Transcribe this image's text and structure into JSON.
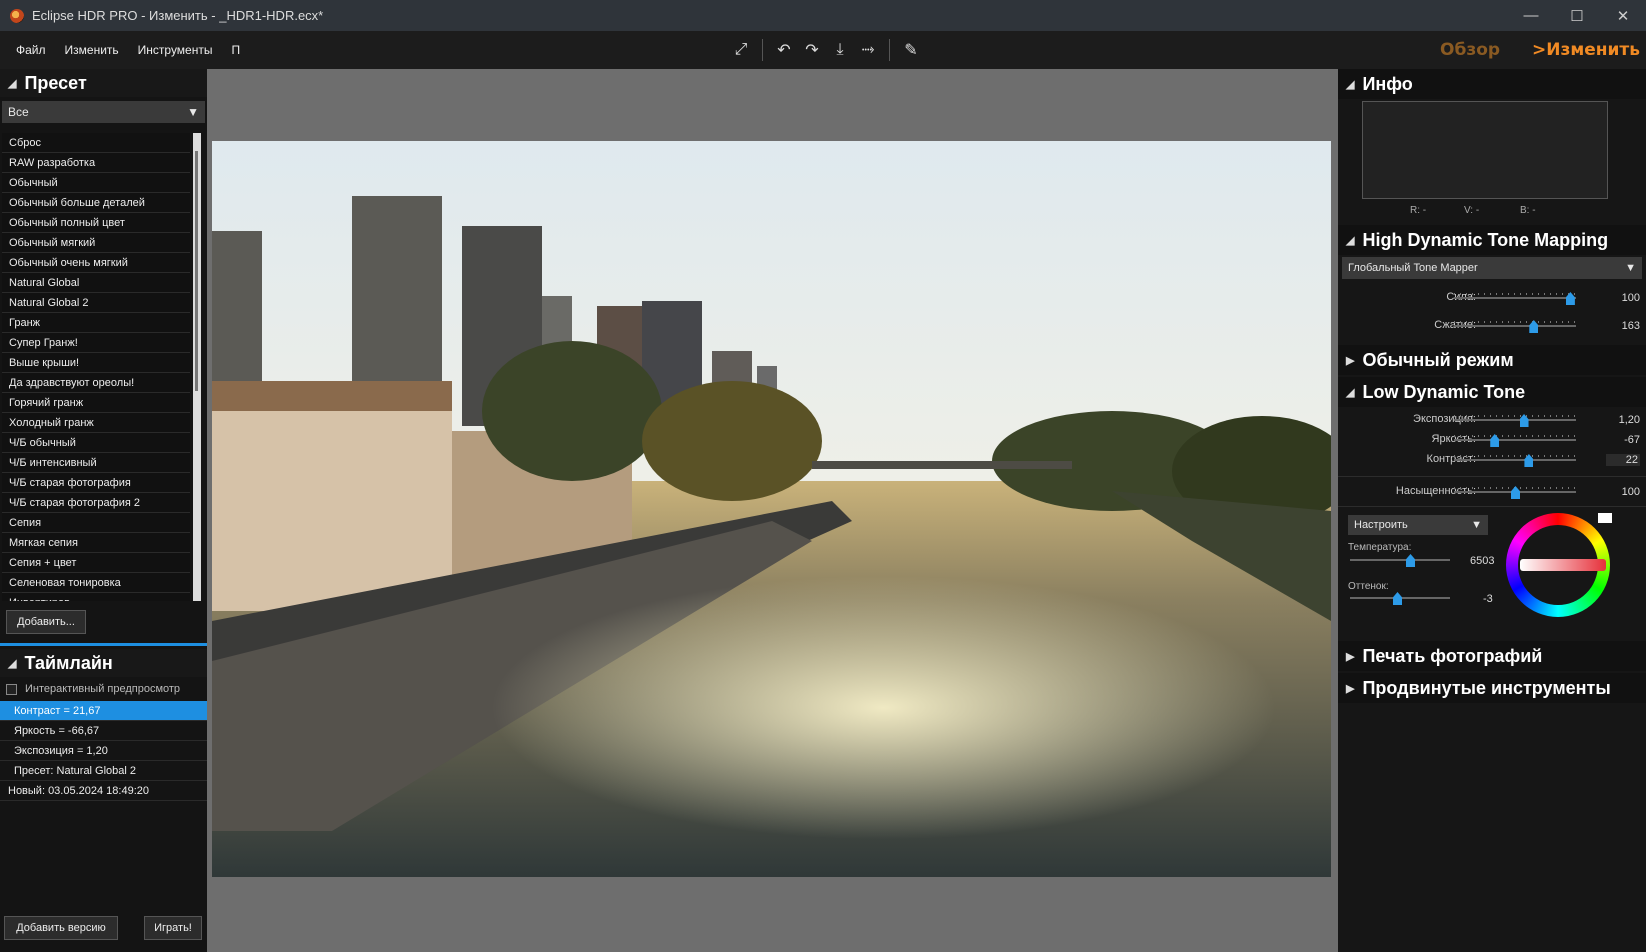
{
  "window": {
    "title": "Eclipse HDR PRO - Изменить - _HDR1-HDR.ecx*"
  },
  "menu": [
    "Файл",
    "Изменить",
    "Инструменты",
    "П"
  ],
  "modes": {
    "overview": "Обзор",
    "edit": ">Изменить"
  },
  "preset": {
    "title": "Пресет",
    "filter": "Все",
    "items": [
      "Сброс",
      "RAW разработка",
      "Обычный",
      "Обычный больше деталей",
      "Обычный полный цвет",
      "Обычный мягкий",
      "Обычный очень мягкий",
      "Natural Global",
      "Natural Global 2",
      "Гранж",
      "Супер Гранж!",
      "Выше крыши!",
      "Да здравствуют ореолы!",
      "Горячий гранж",
      "Холодный гранж",
      "Ч/Б обычный",
      "Ч/Б интенсивный",
      "Ч/Б старая фотография",
      "Ч/Б старая фотография 2",
      "Сепия",
      "Мягкая сепия",
      "Сепия + цвет",
      "Селеновая тонировка",
      "Инвертиров..."
    ],
    "add_button": "Добавить..."
  },
  "timeline": {
    "title": "Таймлайн",
    "interactive_preview": "Интерактивный предпросмотр",
    "items": [
      "Контраст = 21,67",
      "Яркость = -66,67",
      "Экспозиция = 1,20",
      "Пресет: Natural Global 2",
      "Новый: 03.05.2024 18:49:20"
    ],
    "add_version_button": "Добавить версию",
    "play_button": "Играть!"
  },
  "info": {
    "title": "Инфо",
    "r": "R: -",
    "v": "V: -",
    "b": "B: -"
  },
  "hdtm": {
    "title": "High Dynamic Tone Mapping",
    "mapper": "Глобальный Tone Mapper",
    "strength_label": "Сила:",
    "strength_value": "100",
    "strength_pos": 0.95,
    "compression_label": "Сжатие:",
    "compression_value": "163",
    "compression_pos": 0.65
  },
  "normal_mode": {
    "title": "Обычный режим"
  },
  "ldt": {
    "title": "Low Dynamic Tone",
    "exposure_label": "Экспозиция:",
    "exposure_value": "1,20",
    "exposure_pos": 0.57,
    "brightness_label": "Яркость:",
    "brightness_value": "-67",
    "brightness_pos": 0.33,
    "contrast_label": "Контраст:",
    "contrast_value": "22",
    "contrast_pos": 0.61,
    "saturation_label": "Насыщенность:",
    "saturation_value": "100",
    "saturation_pos": 0.5,
    "adjust_select": "Настроить",
    "temperature_label": "Температура:",
    "temperature_value": "6503",
    "temperature_pos": 0.6,
    "tint_label": "Оттенок:",
    "tint_value": "-3",
    "tint_pos": 0.47
  },
  "print": {
    "title": "Печать фотографий"
  },
  "advanced": {
    "title": "Продвинутые инструменты"
  },
  "colors": {
    "accent": "#1e8fe1",
    "orange": "#f08a24"
  }
}
